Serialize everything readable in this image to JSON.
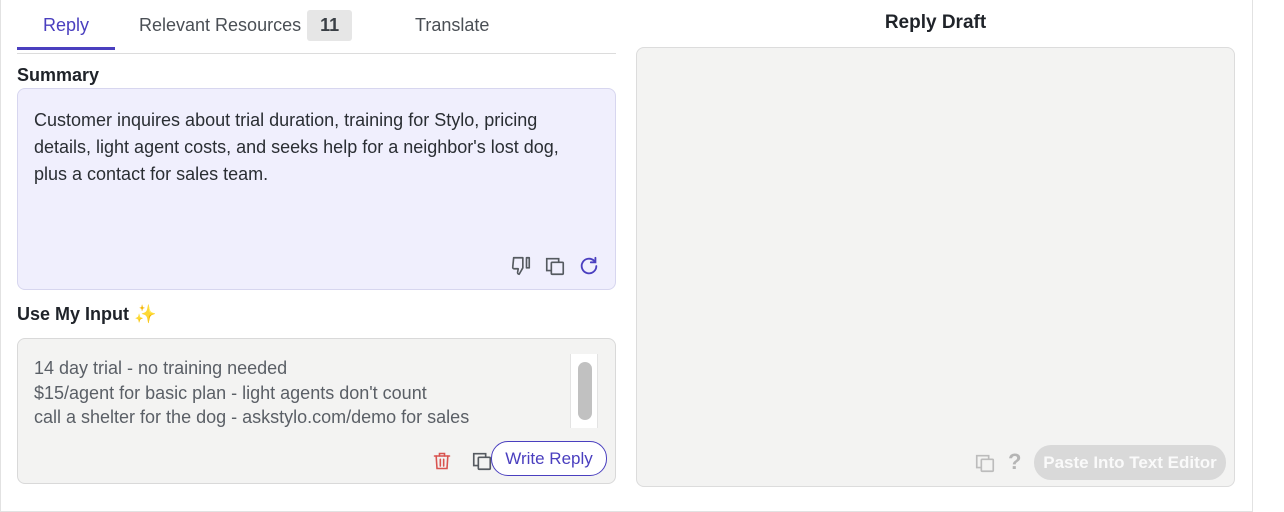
{
  "tabs": {
    "reply": "Reply",
    "resources": "Relevant Resources",
    "resources_count": "11",
    "translate": "Translate"
  },
  "summary": {
    "label": "Summary",
    "text": "Customer inquires about trial duration, training for Stylo, pricing details, light agent costs, and seeks help for a neighbor's lost dog, plus a contact for sales team.",
    "icons": [
      "thumbs-down-icon",
      "copy-icon",
      "refresh-icon"
    ]
  },
  "input": {
    "label": "Use My Input ✨",
    "text": "14 day trial - no training needed\n$15/agent for basic plan - light agents don't count\ncall a shelter for the dog - askstylo.com/demo for sales",
    "write_reply": "Write Reply",
    "icons": [
      "trash-icon",
      "copy-icon"
    ]
  },
  "draft": {
    "title": "Reply Draft",
    "paste_button": "Paste Into Text Editor",
    "help": "?"
  },
  "colors": {
    "accent": "#4a3fbf",
    "summary_bg": "#f0effd",
    "delete": "#d9534f"
  }
}
